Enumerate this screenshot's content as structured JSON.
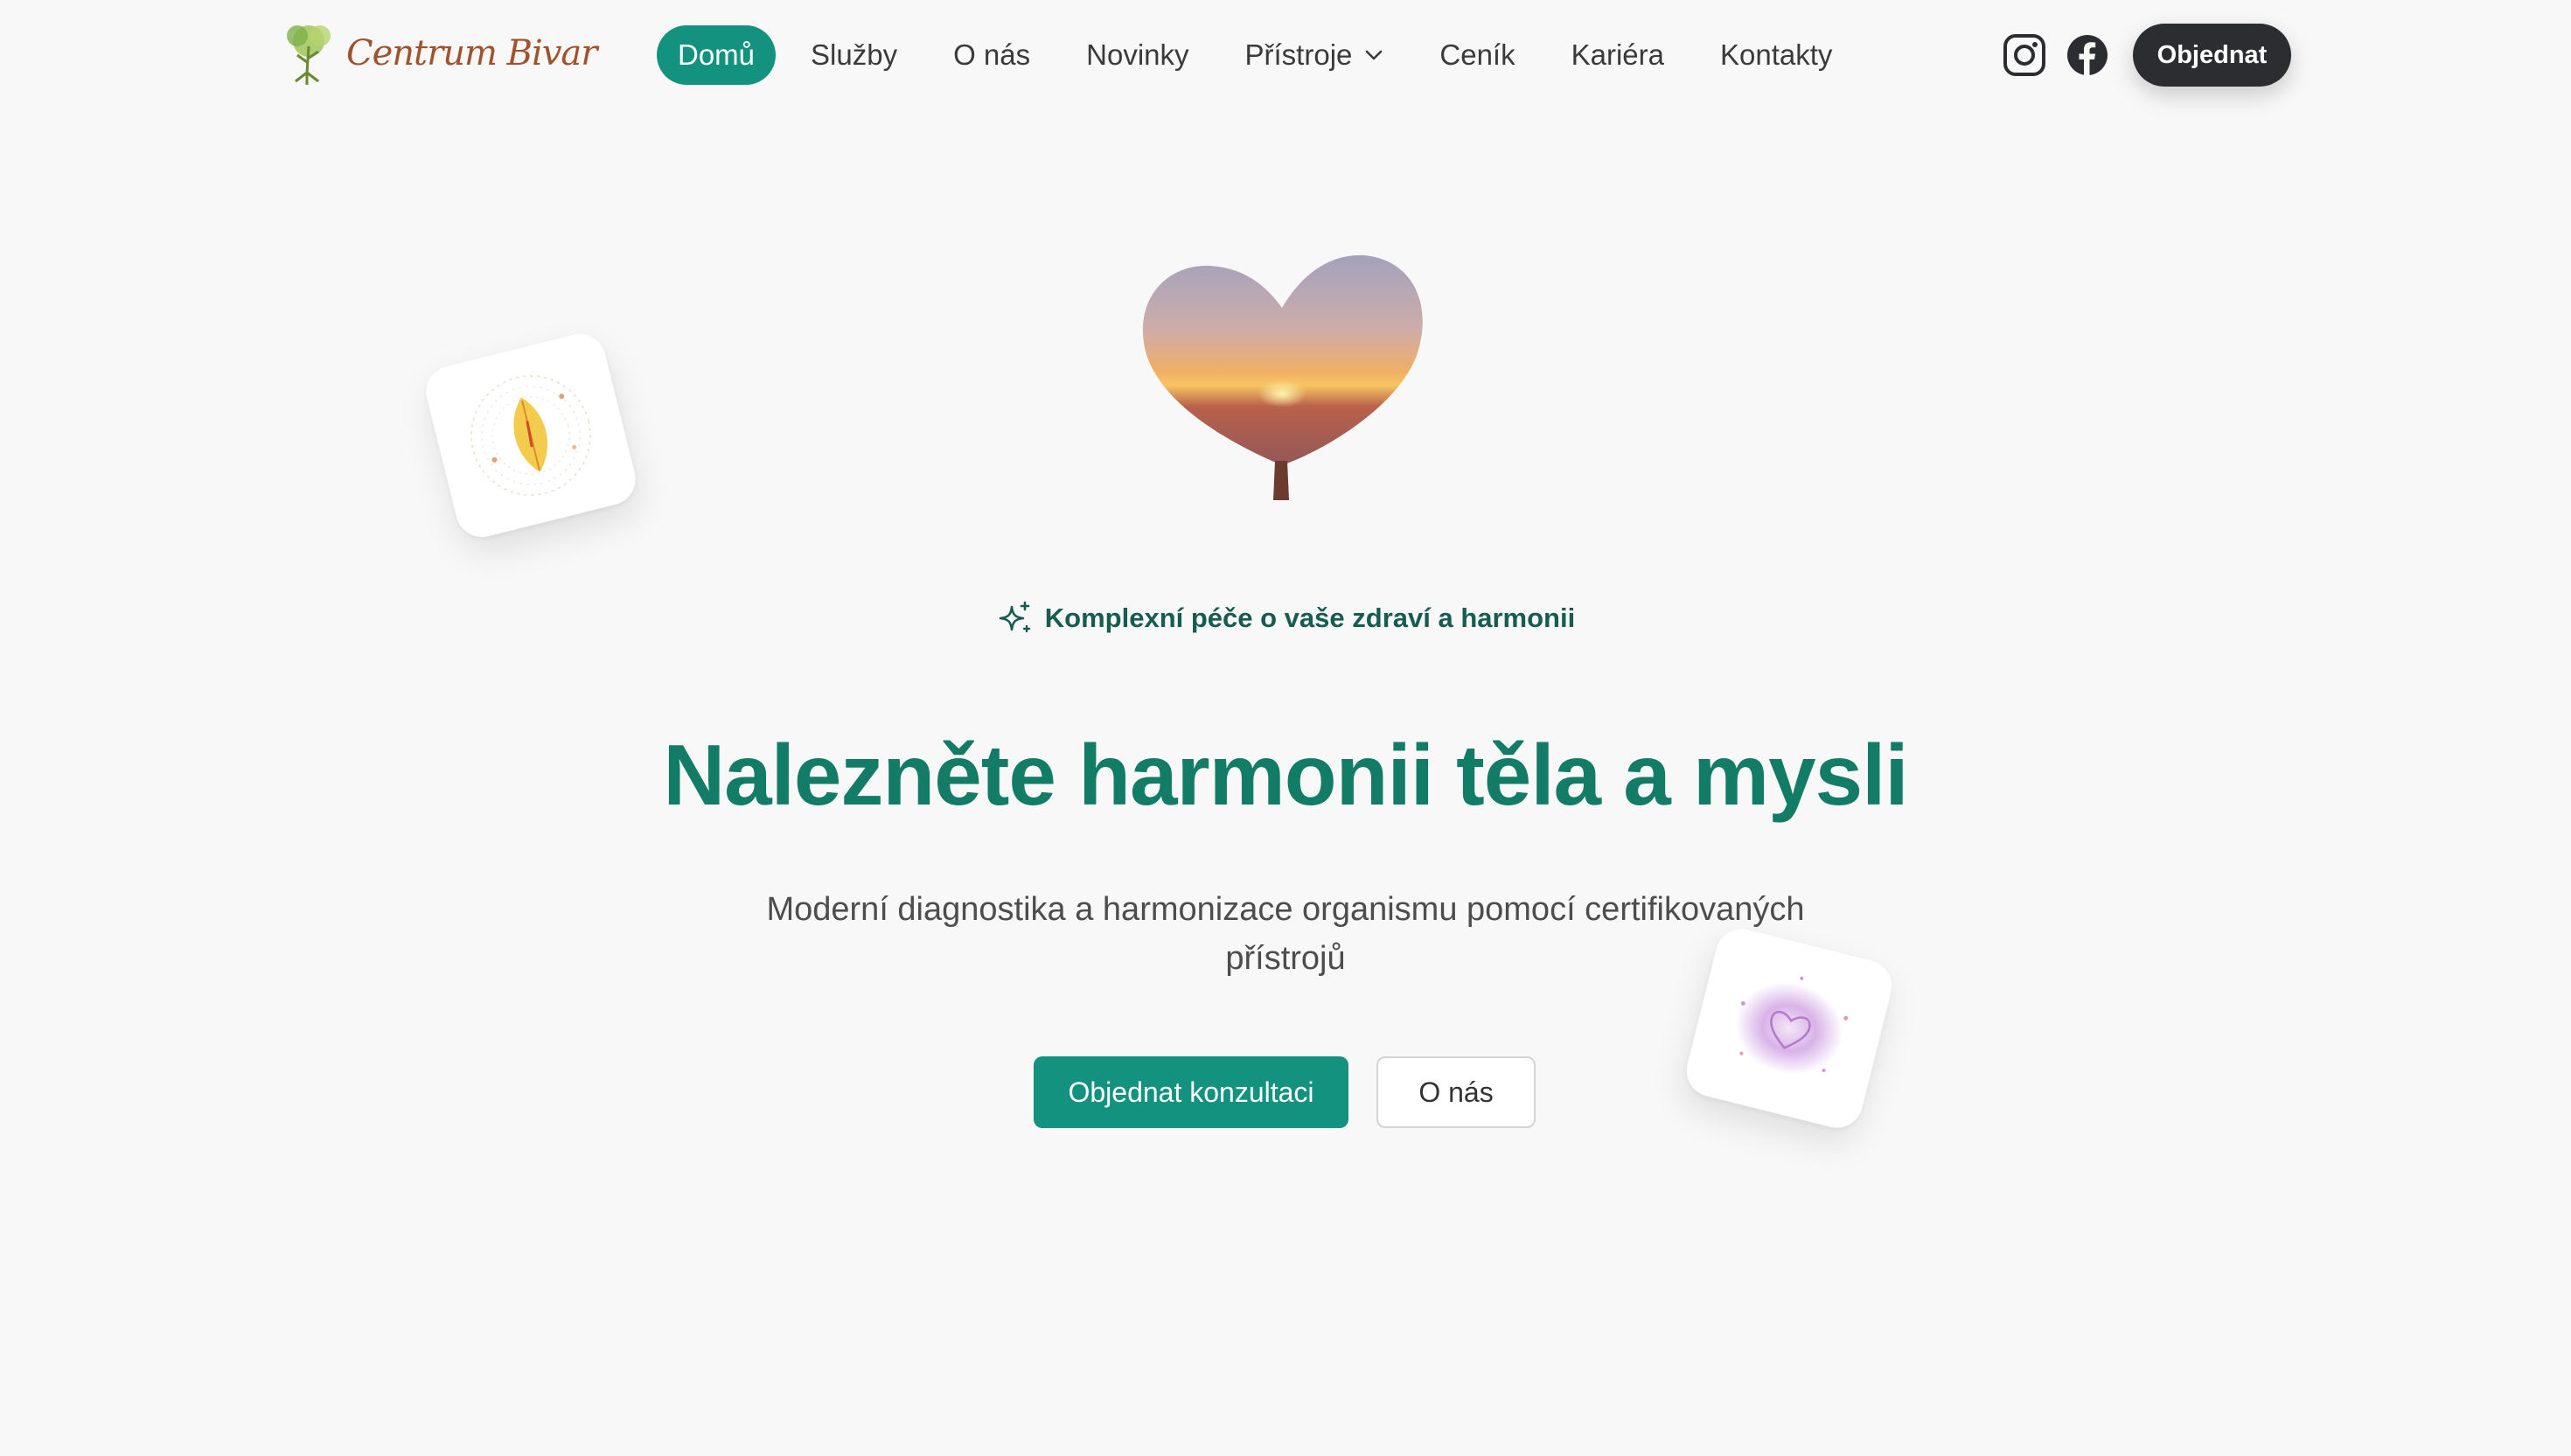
{
  "logo": {
    "text": "Centrum Bivar",
    "icon": "tree-logo-icon"
  },
  "nav": {
    "items": [
      {
        "label": "Domů",
        "active": true
      },
      {
        "label": "Služby"
      },
      {
        "label": "O nás"
      },
      {
        "label": "Novinky"
      },
      {
        "label": "Přístroje",
        "dropdown": true
      },
      {
        "label": "Ceník"
      },
      {
        "label": "Kariéra"
      },
      {
        "label": "Kontakty"
      }
    ],
    "social": [
      "instagram-icon",
      "facebook-icon"
    ],
    "cta": "Objednat"
  },
  "hero": {
    "tagline": "Komplexní péče o vaše zdraví a harmonii",
    "tagline_icon": "sparkles-icon",
    "headline": "Nalezněte harmonii těla a mysli",
    "subtitle": "Moderní diagnostika a harmonizace organismu pomocí certifikovaných přístrojů",
    "primary_button": "Objednat konzultaci",
    "secondary_button": "O nás"
  },
  "colors": {
    "accent": "#13937f",
    "headline": "#137c66",
    "dark_button": "#2b2d30",
    "background": "#f8f8f8"
  }
}
